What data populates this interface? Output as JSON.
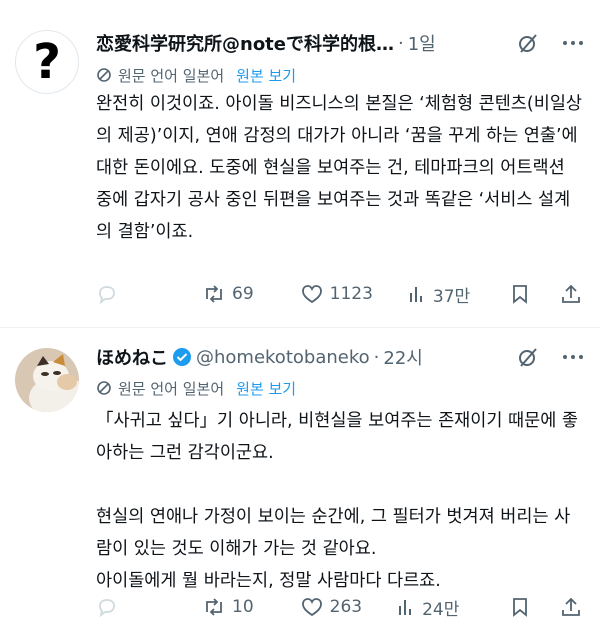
{
  "posts": [
    {
      "author_name": "恋愛科学研究所@noteで科学的根…",
      "handle": "",
      "time": "1일",
      "verified": false,
      "translation_note": "원문 언어 일본어",
      "translation_link": "원본 보기",
      "text": "완전히 이것이죠. 아이돌 비즈니스의 본질은 ‘체험형 콘텐츠(비일상의 제공)’이지, 연애 감정의 대가가 아니라 ‘꿈을 꾸게 하는 연출’에 대한 돈이에요. 도중에 현실을 보여주는 건, 테마파크의 어트랙션 중에 갑자기 공사 중인 뒤편을 보여주는 것과 똑같은 ‘서비스 설계의 결함’이죠.",
      "reposts": "69",
      "likes": "1123",
      "views": "37만"
    },
    {
      "author_name": "ほめねこ",
      "handle": "@homekotobaneko",
      "time": "22시",
      "verified": true,
      "translation_note": "원문 언어 일본어",
      "translation_link": "원본 보기",
      "text": "「사귀고 싶다」기 아니라, 비현실을 보여주는 존재이기 때문에 좋아하는 그런 감각이군요.\n\n현실의 연애나 가정이 보이는 순간에, 그 필터가 벗겨져 버리는 사람이 있는 것도 이해가 가는 것 같아요.\n아이돌에게 뭘 바라는지, 정말 사람마다 다르죠.",
      "reposts": "10",
      "likes": "263",
      "views": "24만"
    }
  ],
  "colors": {
    "accent": "#1d9bf0",
    "muted": "#536471",
    "text": "#0f1419"
  },
  "icons": [
    "grok-icon",
    "more-icon",
    "translate-icon",
    "reply-icon",
    "repost-icon",
    "like-icon",
    "views-icon",
    "bookmark-icon",
    "share-icon",
    "verified-icon"
  ]
}
